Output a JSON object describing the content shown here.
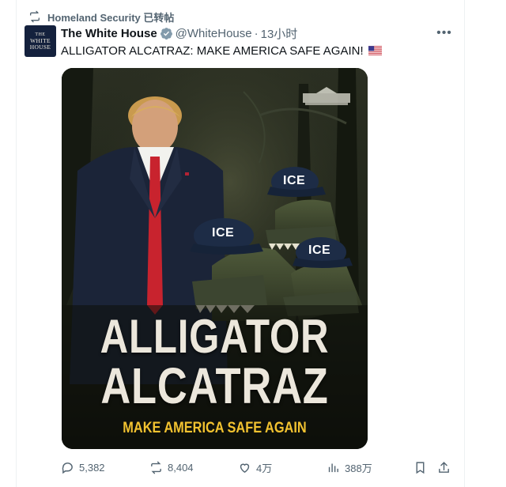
{
  "repost": {
    "label": "Homeland Security 已转帖",
    "icon": "repost-icon"
  },
  "author": {
    "avatar_top": "THE",
    "avatar_main": "WHITE HOUSE",
    "name": "The White House",
    "handle": "@WhiteHouse",
    "separator": "·",
    "time": "13小时"
  },
  "tweet": {
    "text": "ALLIGATOR ALCATRAZ: MAKE AMERICA SAFE AGAIN!",
    "emoji": "us-flag"
  },
  "media": {
    "title_line1": "ALLIGATOR",
    "title_line2": "ALCATRAZ",
    "slogan": "MAKE AMERICA SAFE AGAIN",
    "cap1": "ICE",
    "cap2": "ICE",
    "cap3": "ICE"
  },
  "actions": {
    "replies": "5,382",
    "reposts": "8,404",
    "likes": "4万",
    "views": "388万"
  },
  "colors": {
    "accent": "#1d9bf0",
    "muted": "#536471",
    "text": "#0f1419",
    "slogan": "#f2c230"
  }
}
